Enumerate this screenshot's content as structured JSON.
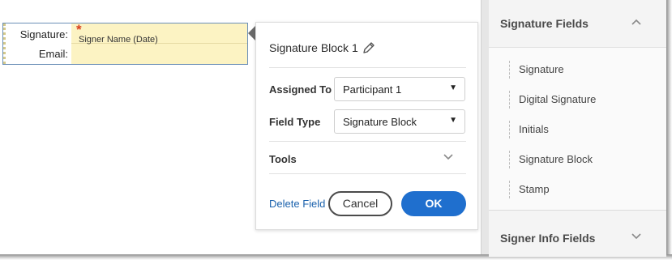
{
  "canvas": {
    "signature_label": "Signature:",
    "email_label": "Email:",
    "required_marker": "*",
    "signature_placeholder": "Signer Name (Date)"
  },
  "popup": {
    "title": "Signature Block 1",
    "assigned_to_label": "Assigned To",
    "assigned_to_value": "Participant 1",
    "field_type_label": "Field Type",
    "field_type_value": "Signature Block",
    "tools_label": "Tools",
    "delete_label": "Delete Field",
    "cancel_label": "Cancel",
    "ok_label": "OK",
    "caret": "▼"
  },
  "panel": {
    "signature_fields_title": "Signature Fields",
    "items": [
      "Signature",
      "Digital Signature",
      "Initials",
      "Signature Block",
      "Stamp"
    ],
    "signer_info_title": "Signer Info Fields"
  },
  "colors": {
    "accent": "#1f6fce",
    "link": "#1b62ad",
    "required": "#d9411e",
    "field_fill": "#fcf3c3"
  },
  "icons": {
    "edit": "pencil-icon",
    "expand": "chevron-down-icon",
    "collapse": "chevron-up-icon",
    "dropdown": "caret-down-icon"
  }
}
